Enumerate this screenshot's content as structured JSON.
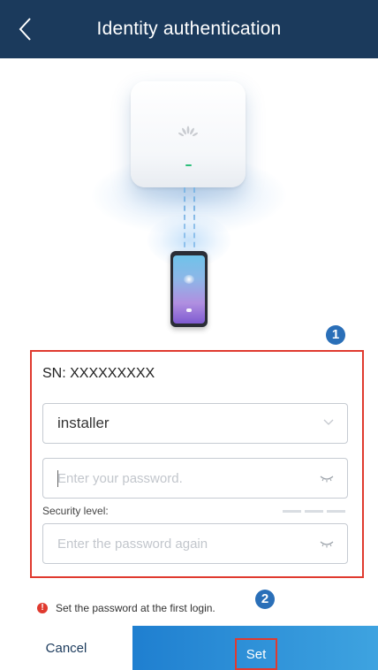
{
  "header": {
    "title": "Identity authentication"
  },
  "form": {
    "sn_label": "SN: XXXXXXXXX",
    "user_value": "installer",
    "password_placeholder": "Enter your password.",
    "security_label": "Security level:",
    "confirm_placeholder": "Enter the password again"
  },
  "hint": {
    "text": "Set the password at the first login."
  },
  "footer": {
    "cancel_label": "Cancel",
    "set_label": "Set"
  },
  "callouts": {
    "one": "1",
    "two": "2"
  },
  "colors": {
    "header": "#1b3a5c",
    "accent": "#2a6fb8",
    "highlight": "#e03a2f"
  }
}
